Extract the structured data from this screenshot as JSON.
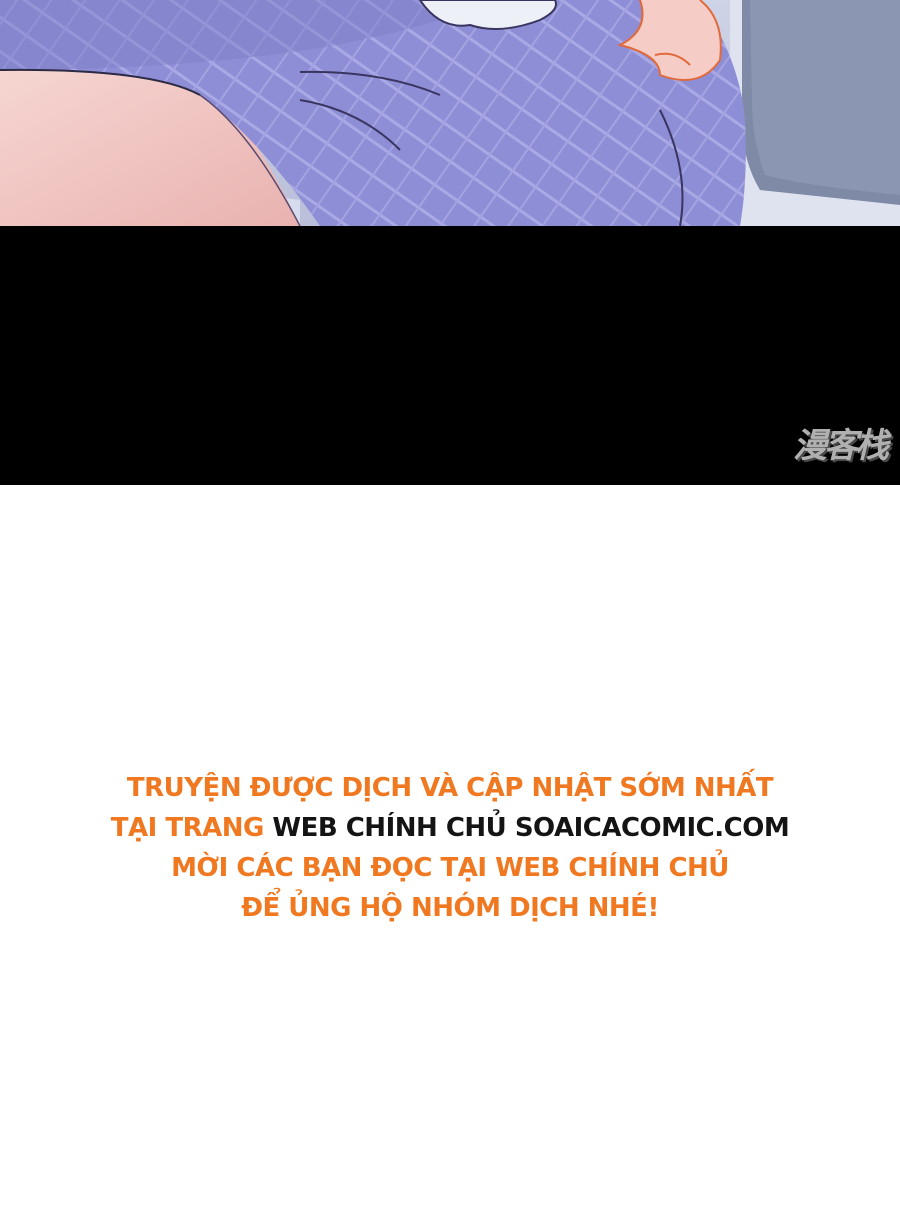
{
  "watermark": {
    "text": "漫客栈"
  },
  "notice": {
    "line1": "TRUYỆN ĐƯỢC DỊCH VÀ CẬP NHẬT SỚM NHẤT",
    "line2_prefix": "TẠI TRANG ",
    "line2_highlight": "WEB CHÍNH CHỦ SOAICACOMIC.COM",
    "line3": "MỜI CÁC BẠN ĐỌC TẠI WEB CHÍNH CHỦ",
    "line4": "ĐỂ ỦNG HỘ NHÓM DỊCH NHÉ!"
  },
  "colors": {
    "accent_orange": "#f07820",
    "highlight_dark": "#141414",
    "band_black": "#000000",
    "fabric_lavender": "#8f8fd8",
    "skin_pink": "#f2c6c4",
    "background_white": "#ffffff"
  }
}
